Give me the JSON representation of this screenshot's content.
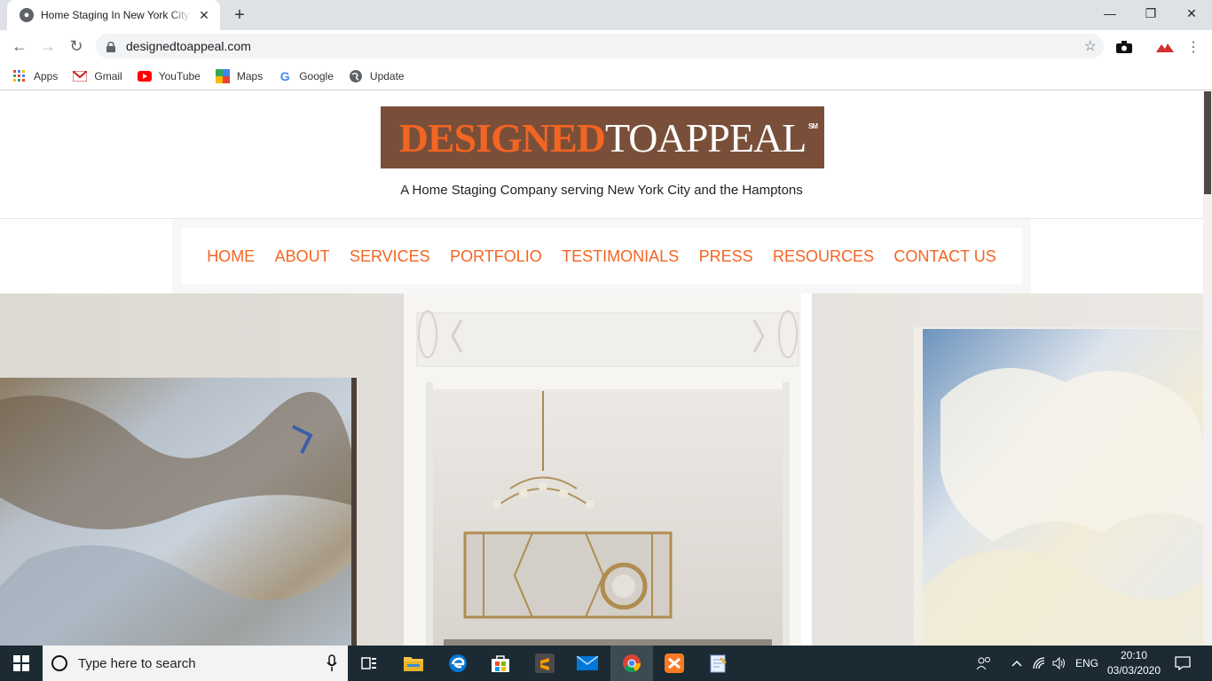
{
  "browser": {
    "tab_title": "Home Staging In New York City and the Hamptons",
    "url": "designedtoappeal.com",
    "bookmarks": [
      {
        "label": "Apps",
        "icon": "apps-grid-icon"
      },
      {
        "label": "Gmail",
        "icon": "gmail-icon"
      },
      {
        "label": "YouTube",
        "icon": "youtube-icon"
      },
      {
        "label": "Maps",
        "icon": "maps-icon"
      },
      {
        "label": "Google",
        "icon": "google-icon"
      },
      {
        "label": "Update",
        "icon": "globe-icon"
      }
    ]
  },
  "site": {
    "logo_part1": "DESIGNED",
    "logo_part2": "TOAPPEAL",
    "logo_mark": "SM",
    "tagline": "A Home Staging Company serving New York City and the Hamptons",
    "nav": [
      "HOME",
      "ABOUT",
      "SERVICES",
      "PORTFOLIO",
      "TESTIMONIALS",
      "PRESS",
      "RESOURCES",
      "CONTACT US"
    ],
    "colors": {
      "accent": "#f26522",
      "logo_bg": "#7a4f3a"
    }
  },
  "taskbar": {
    "search_placeholder": "Type here to search",
    "language": "ENG",
    "time": "20:10",
    "date": "03/03/2020"
  }
}
